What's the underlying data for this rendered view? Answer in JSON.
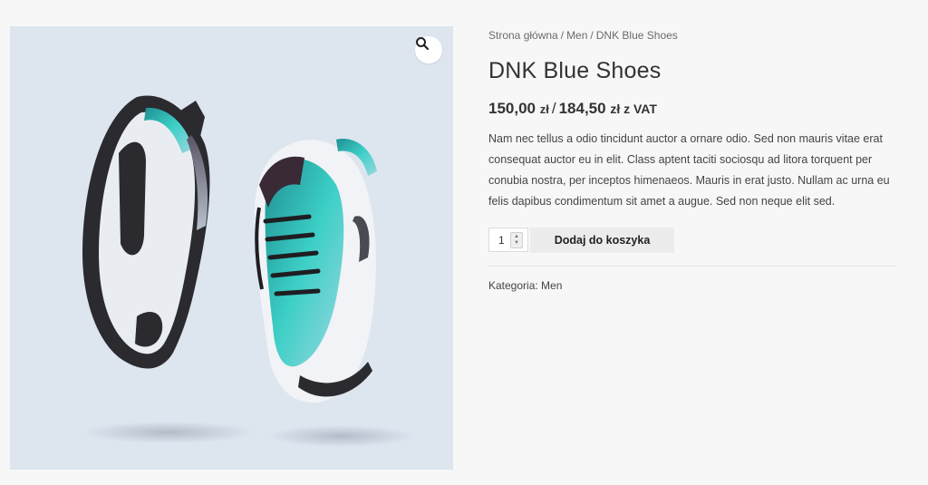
{
  "breadcrumb": {
    "home": "Strona główna",
    "separator": "/",
    "category": "Men",
    "current": "DNK Blue Shoes"
  },
  "product": {
    "title": "DNK Blue Shoes",
    "price_net": "150,00",
    "price_net_currency": "zł",
    "price_separator": "/",
    "price_gross": "184,50",
    "price_gross_currency": "zł z VAT",
    "description": "Nam nec tellus a odio tincidunt auctor a ornare odio. Sed non mauris vitae erat consequat auctor eu in elit. Class aptent taciti sociosqu ad litora torquent per conubia nostra, per inceptos himenaeos. Mauris in erat justo. Nullam ac urna eu felis dapibus condimentum sit amet a augue. Sed non neque elit sed.",
    "image_icon": "product-photo-sneakers"
  },
  "cart": {
    "quantity": "1",
    "add_to_cart_label": "Dodaj do koszyka"
  },
  "meta": {
    "category_label": "Kategoria:",
    "category_value": "Men"
  },
  "icons": {
    "zoom": "magnifier-icon"
  },
  "colors": {
    "image_background": "#dde5ef",
    "accent_teal": "#35c3c1",
    "button_background": "#ececec",
    "page_background": "#f7f7f7"
  }
}
